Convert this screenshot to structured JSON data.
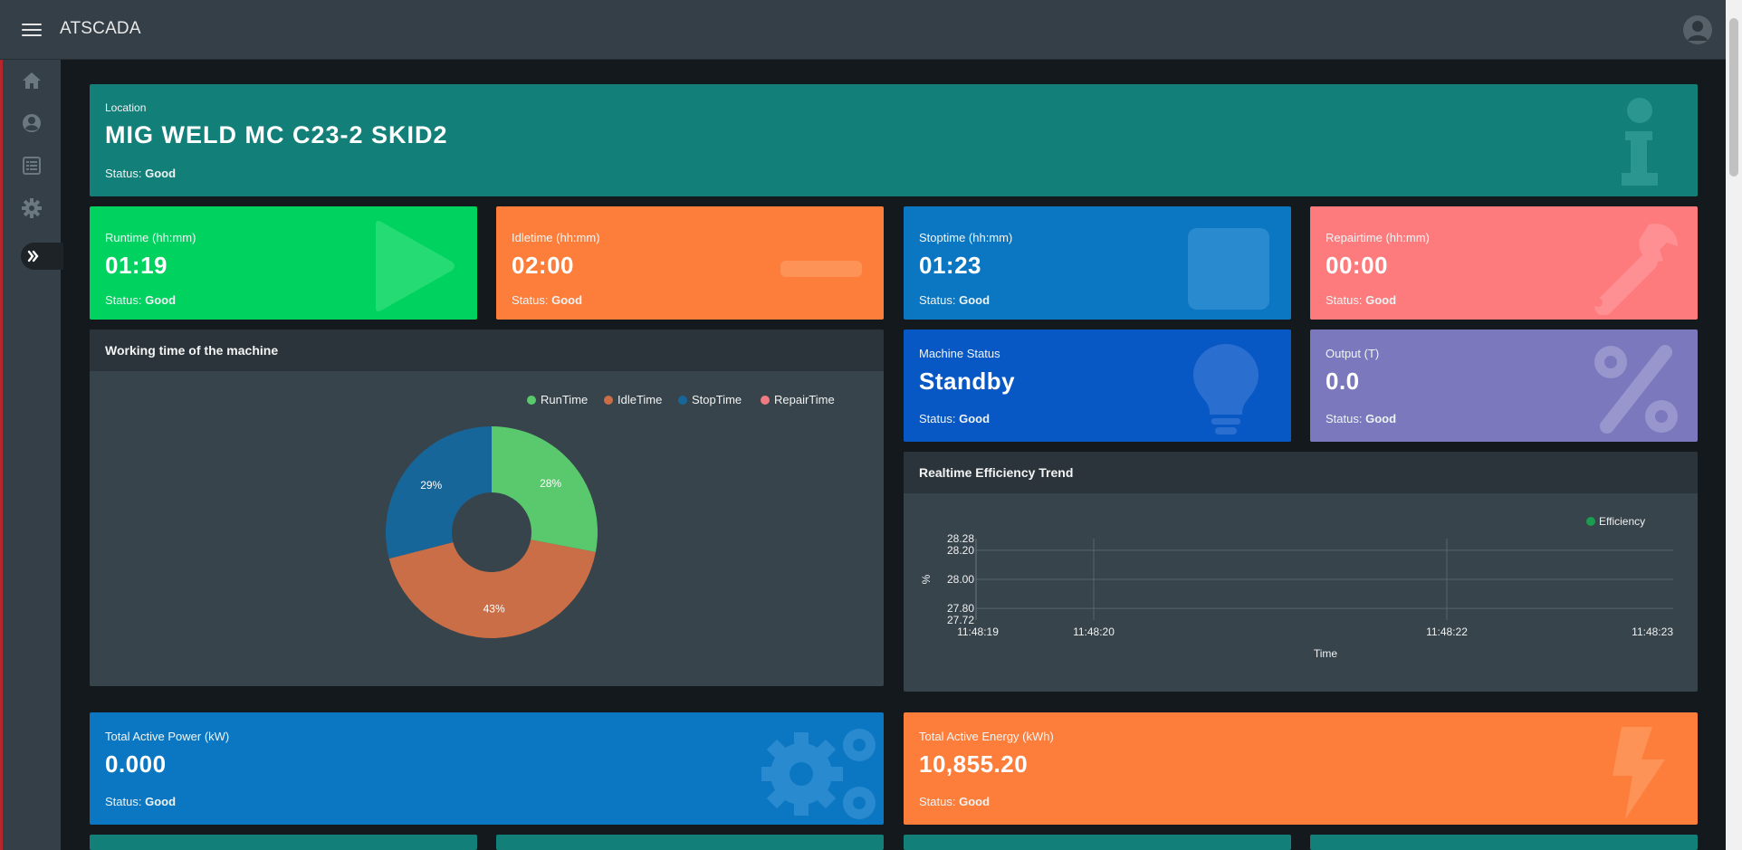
{
  "app": {
    "title": "ATSCADA"
  },
  "sidebar": {
    "items": [
      {
        "name": "home",
        "icon": "home-icon"
      },
      {
        "name": "user",
        "icon": "user-icon"
      },
      {
        "name": "list",
        "icon": "list-icon"
      },
      {
        "name": "settings",
        "icon": "gear-icon"
      }
    ]
  },
  "location": {
    "label": "Location",
    "value": "MIG WELD MC C23-2 SKID2",
    "status_prefix": "Status:",
    "status": "Good"
  },
  "cards": {
    "runtime": {
      "label": "Runtime (hh:mm)",
      "value": "01:19",
      "status_prefix": "Status:",
      "status": "Good"
    },
    "idletime": {
      "label": "Idletime (hh:mm)",
      "value": "02:00",
      "status_prefix": "Status:",
      "status": "Good"
    },
    "stoptime": {
      "label": "Stoptime (hh:mm)",
      "value": "01:23",
      "status_prefix": "Status:",
      "status": "Good"
    },
    "repairtime": {
      "label": "Repairtime (hh:mm)",
      "value": "00:00",
      "status_prefix": "Status:",
      "status": "Good"
    },
    "machine_status": {
      "label": "Machine Status",
      "value": "Standby",
      "status_prefix": "Status:",
      "status": "Good"
    },
    "output": {
      "label": "Output (T)",
      "value": "0.0",
      "status_prefix": "Status:",
      "status": "Good"
    },
    "power": {
      "label": "Total Active Power (kW)",
      "value": "0.000",
      "status_prefix": "Status:",
      "status": "Good"
    },
    "energy": {
      "label": "Total Active Energy (kWh)",
      "value": "10,855.20",
      "status_prefix": "Status:",
      "status": "Good"
    }
  },
  "panels": {
    "working_time": {
      "title": "Working time of the machine"
    },
    "efficiency": {
      "title": "Realtime Efficiency Trend"
    }
  },
  "colors": {
    "teal": "#127f79",
    "green": "#00d25f",
    "orange": "#fd7e3b",
    "blue": "#0b77c2",
    "pink": "#fd7b7d",
    "dark_blue": "#0757c4",
    "purple": "#7b78bd",
    "pie_run": "#5ac96e",
    "pie_idle": "#c96e46",
    "pie_stop": "#17669a",
    "pie_repair": "#f07b82",
    "efficiency_series": "#1c9c4e"
  },
  "chart_data": [
    {
      "type": "pie",
      "style": "donut",
      "categories": [
        "RunTime",
        "IdleTime",
        "StopTime",
        "RepairTime"
      ],
      "values": [
        28,
        43,
        29,
        0
      ],
      "labels": [
        "28%",
        "43%",
        "29%",
        ""
      ],
      "legend": "top-right"
    },
    {
      "type": "line",
      "series": [
        {
          "name": "Efficiency",
          "x": [],
          "values": []
        }
      ],
      "xlabel": "Time",
      "ylabel": "%",
      "x_ticks": [
        "11:48:19",
        "11:48:20",
        "11:48:22",
        "11:48:23"
      ],
      "y_ticks": [
        "28.28",
        "28.20",
        "28.00",
        "27.80",
        "27.72"
      ],
      "ylim": [
        27.72,
        28.28
      ],
      "grid": true,
      "legend": "top-right"
    }
  ]
}
